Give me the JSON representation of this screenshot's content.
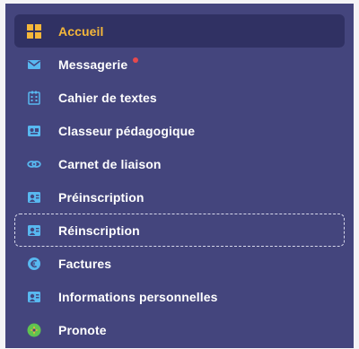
{
  "colors": {
    "sidebar_bg": "#44457d",
    "active_bg": "#303163",
    "active_text": "#f5b73a",
    "icon_blue": "#58b8f0",
    "badge_red": "#e5494d",
    "accent_yellow": "#f5b73a",
    "green": "#5fc44f"
  },
  "nav": {
    "items": [
      {
        "label": "Accueil",
        "icon": "dashboard-grid-icon",
        "active": true
      },
      {
        "label": "Messagerie",
        "icon": "envelope-icon",
        "notification_dot": true
      },
      {
        "label": "Cahier de textes",
        "icon": "planner-icon"
      },
      {
        "label": "Classeur pédagogique",
        "icon": "binder-icon"
      },
      {
        "label": "Carnet de liaison",
        "icon": "link-icon"
      },
      {
        "label": "Préinscription",
        "icon": "id-card-icon"
      },
      {
        "label": "Réinscription",
        "icon": "id-card-icon",
        "focused": true
      },
      {
        "label": "Factures",
        "icon": "euro-icon"
      },
      {
        "label": "Informations personnelles",
        "icon": "id-card-icon"
      },
      {
        "label": "Pronote",
        "icon": "pronote-logo-icon"
      }
    ]
  }
}
